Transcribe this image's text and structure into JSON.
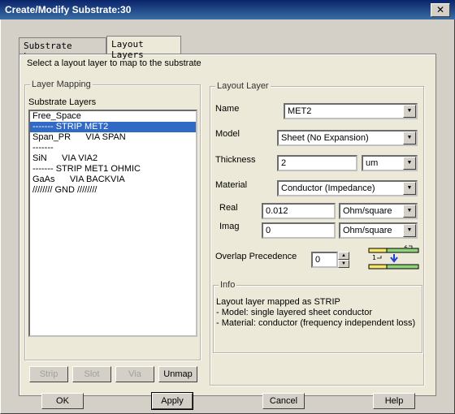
{
  "window": {
    "title": "Create/Modify Substrate:30",
    "close_glyph": "✕"
  },
  "tabs": [
    {
      "label": "Substrate Layers"
    },
    {
      "label": "Layout Layers"
    }
  ],
  "instruction": "Select a layout layer to map to the substrate",
  "layer_mapping": {
    "legend": "Layer Mapping",
    "list_label": "Substrate Layers",
    "items": [
      "Free_Space",
      "------- STRIP MET2",
      "Span_PR      VIA SPAN",
      "-------",
      "SiN      VIA VIA2",
      "------- STRIP MET1 OHMIC",
      "GaAs      VIA BACKVIA",
      "//////// GND ////////"
    ],
    "selected_index": 1,
    "buttons": {
      "strip": "Strip",
      "slot": "Slot",
      "via": "Via",
      "unmap": "Unmap"
    }
  },
  "layout_layer": {
    "legend": "Layout Layer",
    "name_label": "Name",
    "name_value": "MET2",
    "model_label": "Model",
    "model_value": "Sheet (No Expansion)",
    "thickness_label": "Thickness",
    "thickness_value": "2",
    "thickness_unit": "um",
    "material_label": "Material",
    "material_value": "Conductor (Impedance)",
    "real_label": "Real",
    "real_value": "0.012",
    "real_unit": "Ohm/square",
    "imag_label": "Imag",
    "imag_value": "0",
    "imag_unit": "Ohm/square",
    "overlap_label": "Overlap Precedence",
    "overlap_value": "0",
    "overlap_icon": {
      "label_1": "1",
      "label_2": "2"
    }
  },
  "info": {
    "legend": "Info",
    "lines": [
      "Layout layer mapped as STRIP",
      " - Model: single layered sheet conductor",
      " - Material: conductor (frequency independent loss)"
    ]
  },
  "footer": {
    "ok": "OK",
    "apply": "Apply",
    "cancel": "Cancel",
    "help": "Help"
  },
  "icons": {
    "dropdown": "dropdown-arrow-icon",
    "spin_up": "spin-up-icon",
    "spin_down": "spin-down-icon"
  },
  "colors": {
    "title_bar": "#0a246a",
    "selection": "#316ac5",
    "dialog_bg": "#d4d0c8",
    "overlap_yellow": "#f5e66a",
    "overlap_green": "#8fd37a",
    "overlap_arrow": "#1f3fd0"
  }
}
